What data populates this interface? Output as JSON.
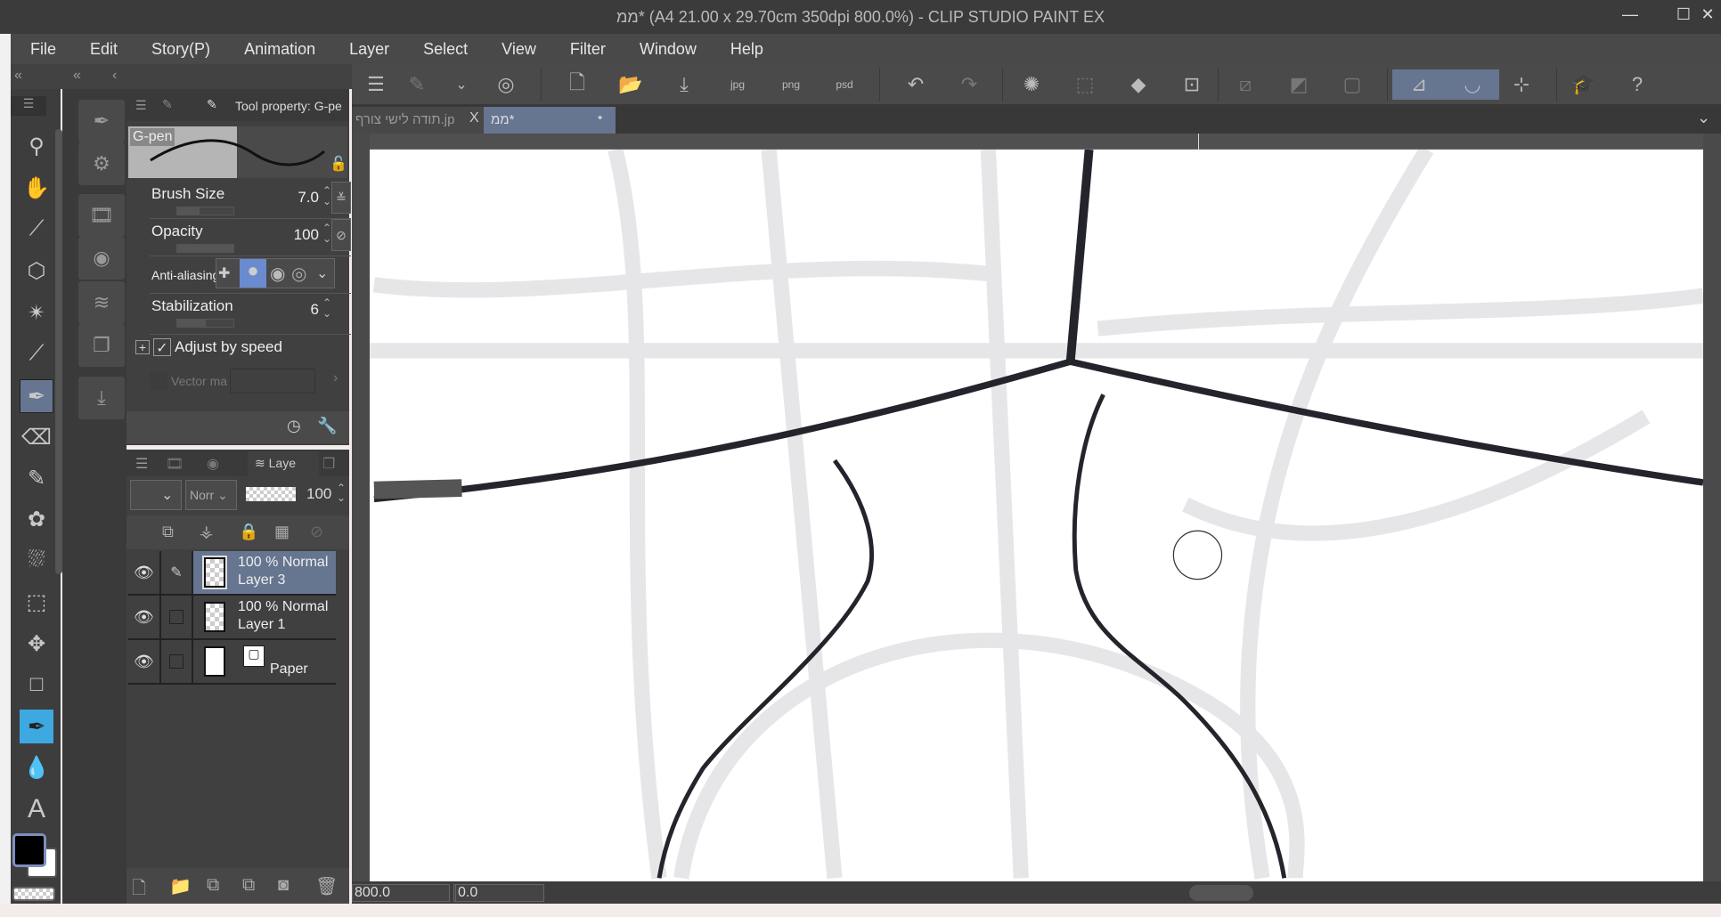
{
  "window": {
    "title": "ממ* (A4 21.00 x 29.70cm 350dpi 800.0%)  - CLIP STUDIO PAINT EX",
    "minimize": "—",
    "maximize": "☐",
    "close": "✕"
  },
  "menu": [
    "File",
    "Edit",
    "Story(P)",
    "Animation",
    "Layer",
    "Select",
    "View",
    "Filter",
    "Window",
    "Help"
  ],
  "tabs": [
    {
      "label": "תודה לישי צורף.jp",
      "close": "X"
    },
    {
      "label": "ממ*",
      "modified": "•"
    }
  ],
  "tool_property": {
    "title": "Tool property: G-pe",
    "brush_name": "G-pen",
    "brush_size": {
      "label": "Brush Size",
      "value": "7.0",
      "fraction": 0.4
    },
    "opacity": {
      "label": "Opacity",
      "value": "100",
      "fraction": 1.0
    },
    "anti_aliasing": {
      "label": "Anti-aliasing"
    },
    "stabilization": {
      "label": "Stabilization",
      "value": "6",
      "fraction": 0.5
    },
    "adjust_by_speed": {
      "label": "Adjust by speed",
      "checked": true
    },
    "vector_magnet": {
      "label": "Vector ma"
    }
  },
  "layer_panel": {
    "tab_label": "Laye",
    "blend_mode": "Norr",
    "opacity": "100",
    "layers": [
      {
        "mode": "100 % Normal",
        "name": "Layer 3",
        "selected": true
      },
      {
        "mode": "100 % Normal",
        "name": "Layer 1",
        "selected": false
      },
      {
        "mode": "",
        "name": "Paper",
        "selected": false
      }
    ]
  },
  "status": {
    "zoom": "800.0",
    "rotation": "0.0"
  },
  "colors": {
    "accent": "#667590",
    "main_color": "#000000",
    "sub_color": "#ffffff"
  }
}
